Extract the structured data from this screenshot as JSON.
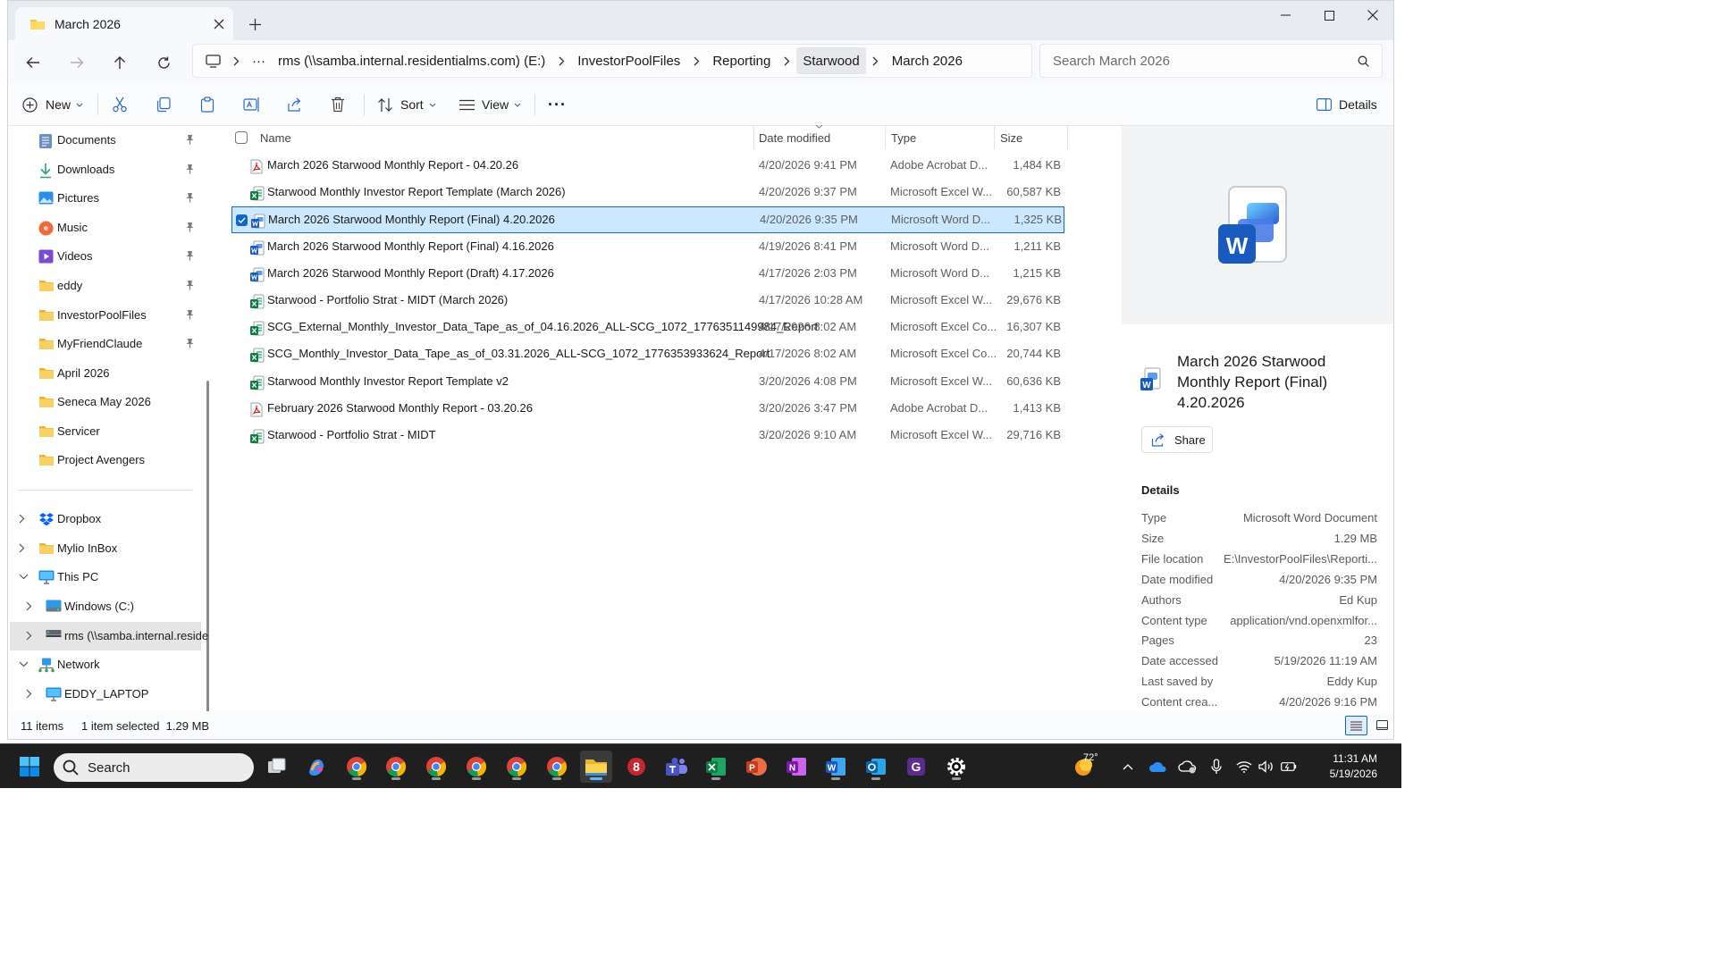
{
  "window": {
    "tab_title": "March 2026",
    "breadcrumbs": [
      "rms (\\\\samba.internal.residentialms.com) (E:)",
      "InvestorPoolFiles",
      "Reporting",
      "Starwood",
      "March 2026"
    ],
    "overflow_label": "···",
    "search_placeholder": "Search March 2026"
  },
  "toolbar": {
    "new_label": "New",
    "sort_label": "Sort",
    "view_label": "View",
    "more_label": "···",
    "details_label": "Details"
  },
  "sidebar": {
    "quick_access": [
      {
        "label": "Documents",
        "icon": "documents-icon",
        "pinned": true
      },
      {
        "label": "Downloads",
        "icon": "downloads-icon",
        "pinned": true
      },
      {
        "label": "Pictures",
        "icon": "pictures-icon",
        "pinned": true
      },
      {
        "label": "Music",
        "icon": "music-icon",
        "pinned": true
      },
      {
        "label": "Videos",
        "icon": "videos-icon",
        "pinned": true
      },
      {
        "label": "eddy",
        "icon": "folder-icon",
        "pinned": true
      },
      {
        "label": "InvestorPoolFiles",
        "icon": "folder-icon",
        "pinned": true
      },
      {
        "label": "MyFriendClaude",
        "icon": "folder-icon",
        "pinned": true
      },
      {
        "label": "April 2026",
        "icon": "folder-icon",
        "pinned": false
      },
      {
        "label": "Seneca May 2026",
        "icon": "folder-icon",
        "pinned": false
      },
      {
        "label": "Servicer",
        "icon": "folder-icon",
        "pinned": false
      },
      {
        "label": "Project Avengers",
        "icon": "folder-icon",
        "pinned": false
      }
    ],
    "tree": [
      {
        "label": "Dropbox",
        "icon": "dropbox-icon",
        "expanded": false,
        "level": 0
      },
      {
        "label": "Mylio InBox",
        "icon": "folder-icon",
        "expanded": false,
        "level": 0
      },
      {
        "label": "This PC",
        "icon": "this-pc-icon",
        "expanded": true,
        "level": 0
      },
      {
        "label": "Windows (C:)",
        "icon": "drive-icon",
        "expanded": false,
        "level": 1
      },
      {
        "label": "rms (\\\\samba.internal.reside",
        "icon": "network-drive-icon",
        "expanded": false,
        "level": 1,
        "selected": true
      },
      {
        "label": "Network",
        "icon": "network-icon",
        "expanded": true,
        "level": 0
      },
      {
        "label": "EDDY_LAPTOP",
        "icon": "computer-icon",
        "expanded": false,
        "level": 1
      }
    ]
  },
  "file_list": {
    "columns": {
      "name": "Name",
      "date": "Date modified",
      "type": "Type",
      "size": "Size"
    },
    "rows": [
      {
        "name": "March 2026 Starwood Monthly Report - 04.20.26",
        "date": "4/20/2026 9:41 PM",
        "type": "Adobe Acrobat D...",
        "size": "1,484 KB",
        "kind": "pdf"
      },
      {
        "name": "Starwood Monthly Investor Report Template (March 2026)",
        "date": "4/20/2026 9:37 PM",
        "type": "Microsoft Excel W...",
        "size": "60,587 KB",
        "kind": "excel"
      },
      {
        "name": "March 2026 Starwood Monthly Report (Final) 4.20.2026",
        "date": "4/20/2026 9:35 PM",
        "type": "Microsoft Word D...",
        "size": "1,325 KB",
        "kind": "word",
        "selected": true
      },
      {
        "name": "March 2026 Starwood Monthly Report (Final) 4.16.2026",
        "date": "4/19/2026 8:41 PM",
        "type": "Microsoft Word D...",
        "size": "1,211 KB",
        "kind": "word"
      },
      {
        "name": "March 2026 Starwood Monthly Report (Draft) 4.17.2026",
        "date": "4/17/2026 2:03 PM",
        "type": "Microsoft Word D...",
        "size": "1,215 KB",
        "kind": "word"
      },
      {
        "name": "Starwood - Portfolio Strat - MIDT (March 2026)",
        "date": "4/17/2026 10:28 AM",
        "type": "Microsoft Excel W...",
        "size": "29,676 KB",
        "kind": "excel"
      },
      {
        "name": "SCG_External_Monthly_Investor_Data_Tape_as_of_04.16.2026_ALL-SCG_1072_1776351149984_Report",
        "date": "4/17/2026 8:02 AM",
        "type": "Microsoft Excel Co...",
        "size": "16,307 KB",
        "kind": "excel"
      },
      {
        "name": "SCG_Monthly_Investor_Data_Tape_as_of_03.31.2026_ALL-SCG_1072_1776353933624_Report",
        "date": "4/17/2026 8:02 AM",
        "type": "Microsoft Excel Co...",
        "size": "20,744 KB",
        "kind": "excel"
      },
      {
        "name": "Starwood Monthly Investor Report Template v2",
        "date": "3/20/2026 4:08 PM",
        "type": "Microsoft Excel W...",
        "size": "60,636 KB",
        "kind": "excel"
      },
      {
        "name": "February 2026 Starwood Monthly Report - 03.20.26",
        "date": "3/20/2026 3:47 PM",
        "type": "Adobe Acrobat D...",
        "size": "1,413 KB",
        "kind": "pdf"
      },
      {
        "name": "Starwood - Portfolio Strat - MIDT",
        "date": "3/20/2026 9:10 AM",
        "type": "Microsoft Excel W...",
        "size": "29,716 KB",
        "kind": "excel"
      }
    ]
  },
  "details_pane": {
    "title": "March 2026 Starwood Monthly Report (Final) 4.20.2026",
    "share_label": "Share",
    "section_label": "Details",
    "props": [
      {
        "key": "Type",
        "value": "Microsoft Word Document"
      },
      {
        "key": "Size",
        "value": "1.29 MB"
      },
      {
        "key": "File location",
        "value": "E:\\InvestorPoolFiles\\Reporti..."
      },
      {
        "key": "Date modified",
        "value": "4/20/2026 9:35 PM"
      },
      {
        "key": "Authors",
        "value": "Ed Kup"
      },
      {
        "key": "Content type",
        "value": "application/vnd.openxmlfor..."
      },
      {
        "key": "Pages",
        "value": "23"
      },
      {
        "key": "Date accessed",
        "value": "5/19/2026 11:19 AM"
      },
      {
        "key": "Last saved by",
        "value": "Eddy Kup"
      },
      {
        "key": "Content crea...",
        "value": "4/20/2026 9:16 PM"
      }
    ]
  },
  "status": {
    "item_count": "11 items",
    "selection": "1 item selected  1.29 MB"
  },
  "taskbar": {
    "search_label": "Search",
    "weather": "72°",
    "time": "11:31 AM",
    "date": "5/19/2026"
  },
  "colors": {
    "accent": "#0f67c7",
    "selection_bg": "#cce8ff",
    "folder": "#f4c44d",
    "word": "#185abd",
    "excel": "#107c41",
    "pdf": "#d4281f"
  }
}
